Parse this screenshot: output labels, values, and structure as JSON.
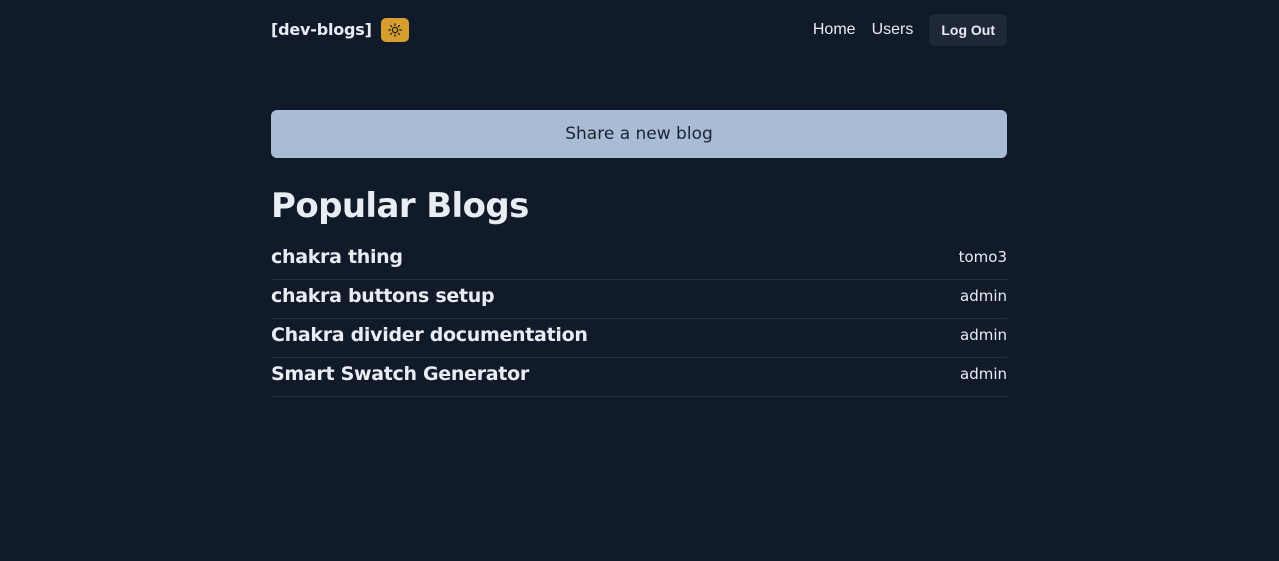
{
  "header": {
    "brand": "[dev-blogs]",
    "theme_toggle_icon": "sun-icon",
    "nav_links": {
      "home": "Home",
      "users": "Users"
    },
    "logout_label": "Log Out"
  },
  "main": {
    "share_button_label": "Share a new blog",
    "section_title": "Popular Blogs",
    "blogs": [
      {
        "title": "chakra thing",
        "author": "tomo3"
      },
      {
        "title": "chakra buttons setup",
        "author": "admin"
      },
      {
        "title": "Chakra divider documentation",
        "author": "admin"
      },
      {
        "title": "Smart Swatch Generator",
        "author": "admin"
      }
    ]
  },
  "colors": {
    "background": "#101a29",
    "text": "#e8edf3",
    "toggle_accent": "#d69e2e",
    "share_button": "#a8bcd6",
    "logout_button": "#1e2838",
    "divider": "#26303f"
  }
}
